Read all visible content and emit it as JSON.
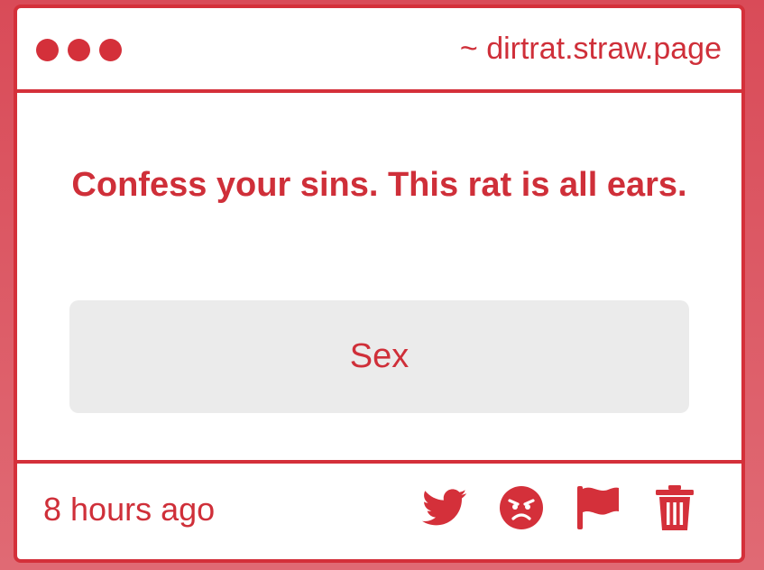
{
  "window": {
    "url": "~ dirtrat.straw.page"
  },
  "prompt": {
    "text": "Confess your sins. This rat is all ears."
  },
  "answer": {
    "text": "Sex"
  },
  "footer": {
    "timestamp": "8 hours ago",
    "actions": [
      {
        "icon": "twitter-icon"
      },
      {
        "icon": "angry-face-icon"
      },
      {
        "icon": "flag-icon"
      },
      {
        "icon": "trash-icon"
      }
    ]
  },
  "colors": {
    "accent": "#d4303a",
    "background": "#d94b58",
    "answer_box": "#ebebeb"
  }
}
